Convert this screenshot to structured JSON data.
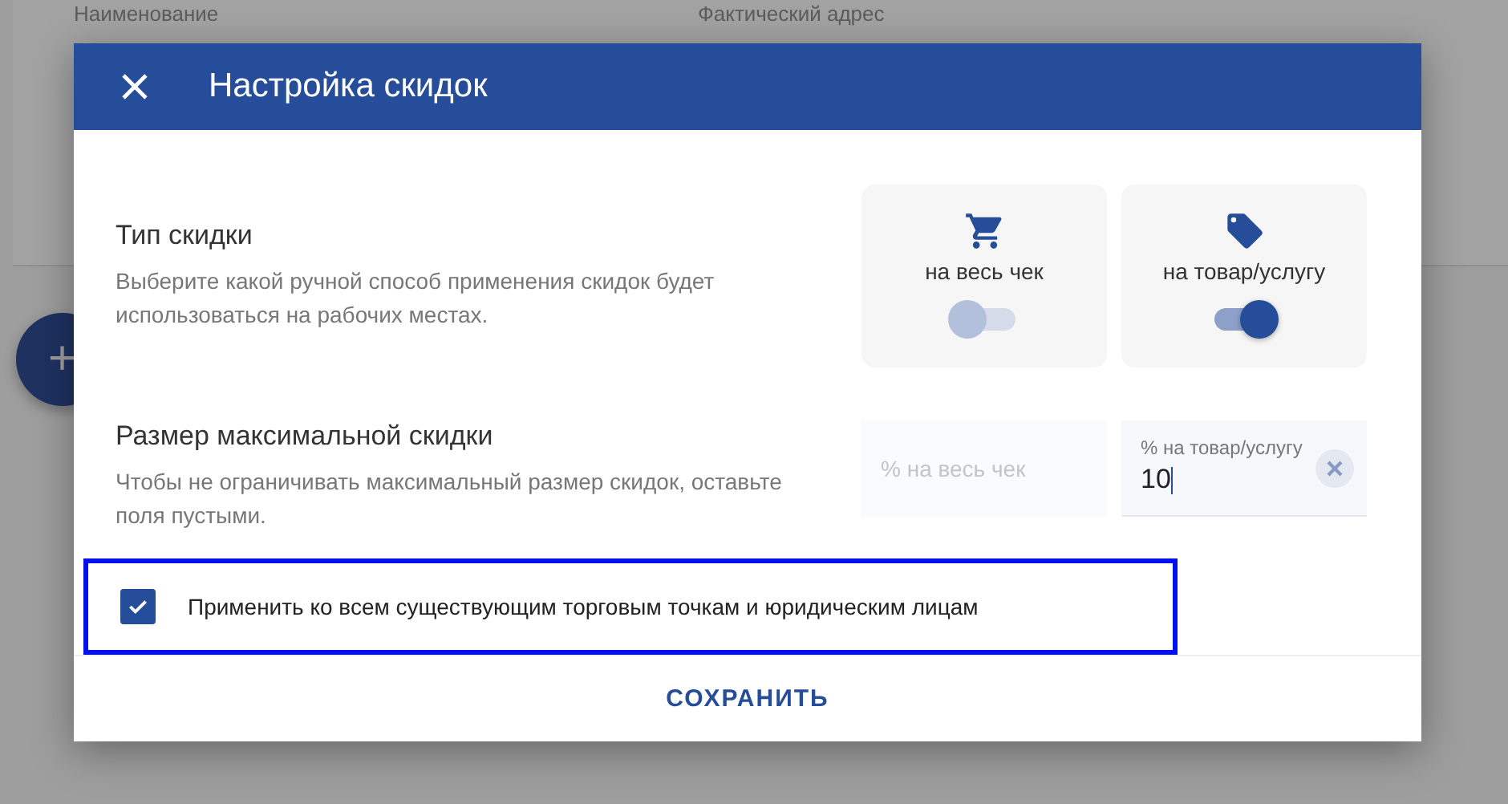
{
  "background": {
    "fields": [
      {
        "label": "Наименование"
      },
      {
        "label": "Фактический адрес"
      }
    ],
    "fab": {
      "label": "+"
    }
  },
  "dialog": {
    "title": "Настройка скидок",
    "discount_type": {
      "title": "Тип скидки",
      "description": "Выберите какой ручной способ применения скидок будет использоваться на рабочих местах.",
      "options": [
        {
          "kind": "cart",
          "label": "на весь чек",
          "on": false
        },
        {
          "kind": "tag",
          "label": "на товар/услугу",
          "on": true
        }
      ]
    },
    "max_discount": {
      "title": "Размер максимальной скидки",
      "description": "Чтобы не ограничивать максимальный размер скидок, оставьте поля пустыми.",
      "fields": [
        {
          "placeholder": "% на весь чек"
        },
        {
          "label": "% на товар/услугу",
          "value": "10"
        }
      ]
    },
    "apply_all": {
      "label": "Применить ко всем существующим торговым точкам и юридическим лицам",
      "checked": true,
      "highlighted": true
    },
    "save_button": "СОХРАНИТЬ"
  }
}
